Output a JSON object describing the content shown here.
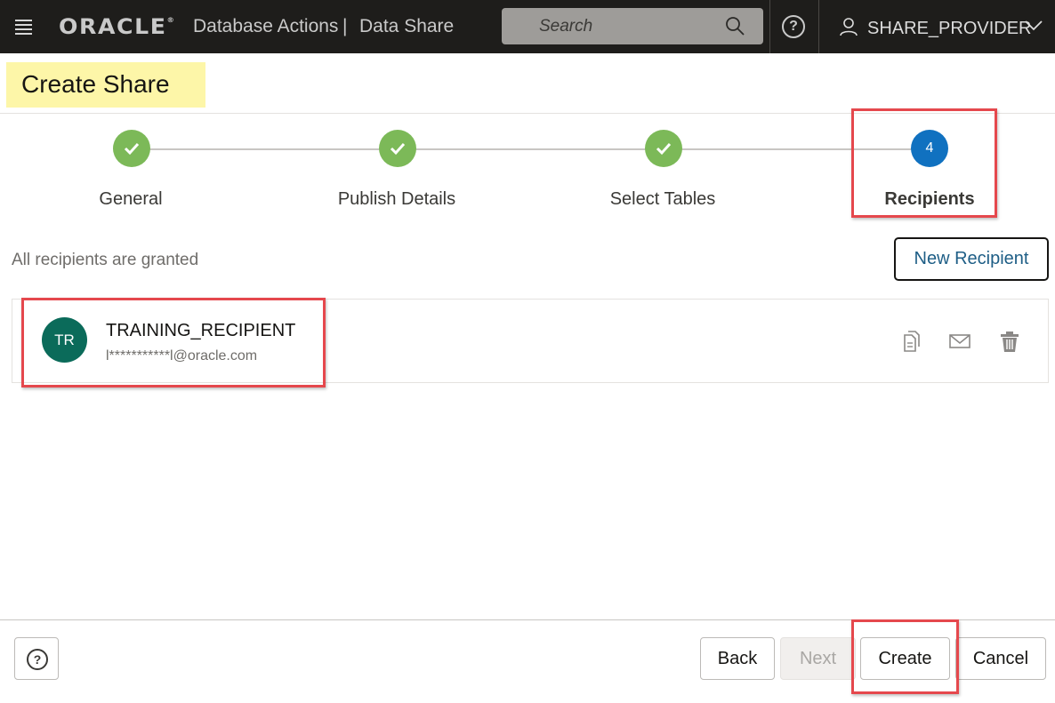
{
  "header": {
    "logo": "ORACLE",
    "logo_reg": "®",
    "app_name": "Database Actions",
    "separator": "|",
    "module": "Data Share",
    "search_placeholder": "Search",
    "help_symbol": "?",
    "user": "SHARE_PROVIDER"
  },
  "page": {
    "title": "Create Share"
  },
  "train": {
    "steps": [
      {
        "label": "General",
        "state": "done"
      },
      {
        "label": "Publish Details",
        "state": "done"
      },
      {
        "label": "Select Tables",
        "state": "done"
      },
      {
        "label": "Recipients",
        "state": "current",
        "number": "4"
      }
    ]
  },
  "recipients": {
    "status_text": "All recipients are granted",
    "new_button": "New Recipient",
    "items": [
      {
        "initials": "TR",
        "name": "TRAINING_RECIPIENT",
        "email": "l***********l@oracle.com",
        "avatar_color": "#0b6b5a"
      }
    ]
  },
  "footer": {
    "help_symbol": "?",
    "back": "Back",
    "next": "Next",
    "create": "Create",
    "cancel": "Cancel"
  },
  "colors": {
    "header_bg": "#1e1d1b",
    "step_done": "#7cb958",
    "step_current": "#1071c0",
    "highlight": "#e5484d",
    "title_highlight": "#fdf6a8",
    "link": "#1e5e86"
  }
}
